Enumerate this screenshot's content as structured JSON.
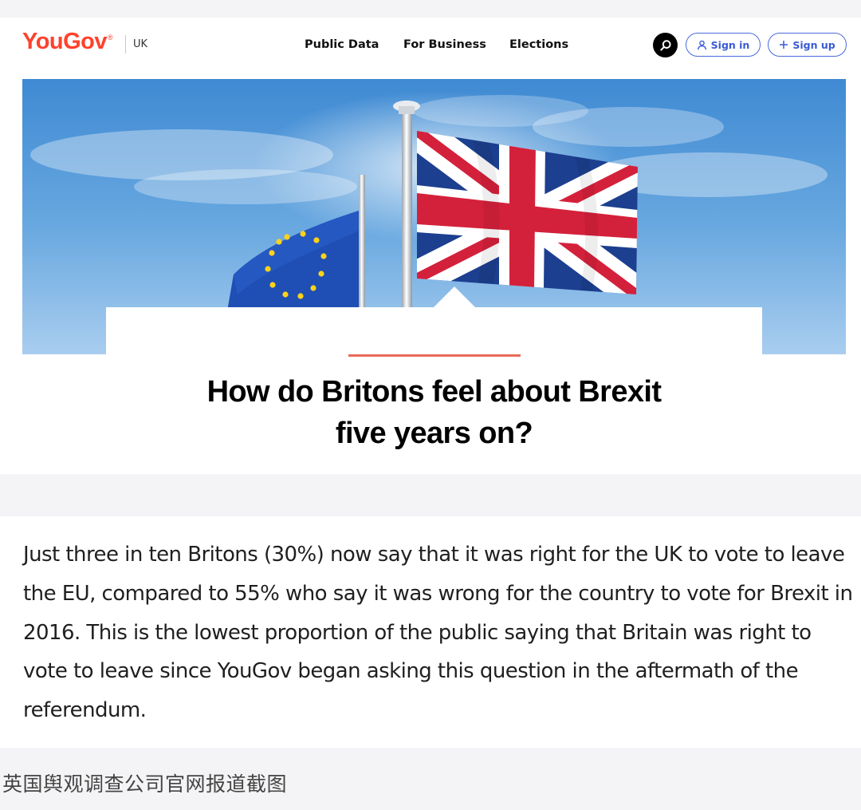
{
  "nav": {
    "logo": "YouGov",
    "logo_mark": "®",
    "region": "UK",
    "links": [
      "Public Data",
      "For Business",
      "Elections"
    ],
    "search_icon": "search-icon",
    "sign_in": "Sign in",
    "sign_in_icon": "user-icon",
    "sign_up": "Sign up",
    "sign_up_icon": "plus-icon"
  },
  "hero": {
    "image": "eu-and-union-jack-flags"
  },
  "article": {
    "title_line1": "How do Britons feel about Brexit",
    "title_line2": "five years on?",
    "paragraph": "Just three in ten Britons (30%) now say that it was right for the UK to vote to leave the EU, compared to 55% who say it was wrong for the country to vote for Brexit in 2016. This is the lowest proportion of the public saying that Britain was right to vote to leave since YouGov began asking this question in the aftermath of the referendum."
  },
  "caption": "英国舆观调查公司官网报道截图",
  "colors": {
    "brand": "#ff412c",
    "button_blue": "#3a5ad6",
    "accent_line": "#e86b5a",
    "sky": "#5b9fd8"
  }
}
